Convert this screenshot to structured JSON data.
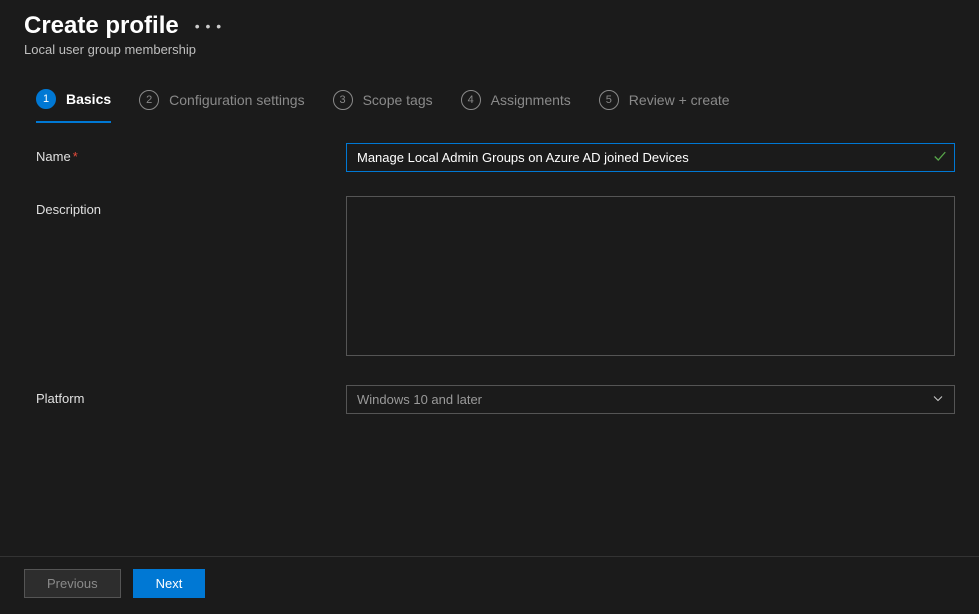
{
  "header": {
    "title": "Create profile",
    "subtitle": "Local user group membership"
  },
  "wizard": {
    "steps": [
      {
        "num": "1",
        "label": "Basics",
        "active": true
      },
      {
        "num": "2",
        "label": "Configuration settings",
        "active": false
      },
      {
        "num": "3",
        "label": "Scope tags",
        "active": false
      },
      {
        "num": "4",
        "label": "Assignments",
        "active": false
      },
      {
        "num": "5",
        "label": "Review + create",
        "active": false
      }
    ]
  },
  "form": {
    "name_label": "Name",
    "name_value": "Manage Local Admin Groups on Azure AD joined Devices",
    "description_label": "Description",
    "description_value": "",
    "platform_label": "Platform",
    "platform_value": "Windows 10 and later"
  },
  "footer": {
    "previous_label": "Previous",
    "next_label": "Next"
  }
}
